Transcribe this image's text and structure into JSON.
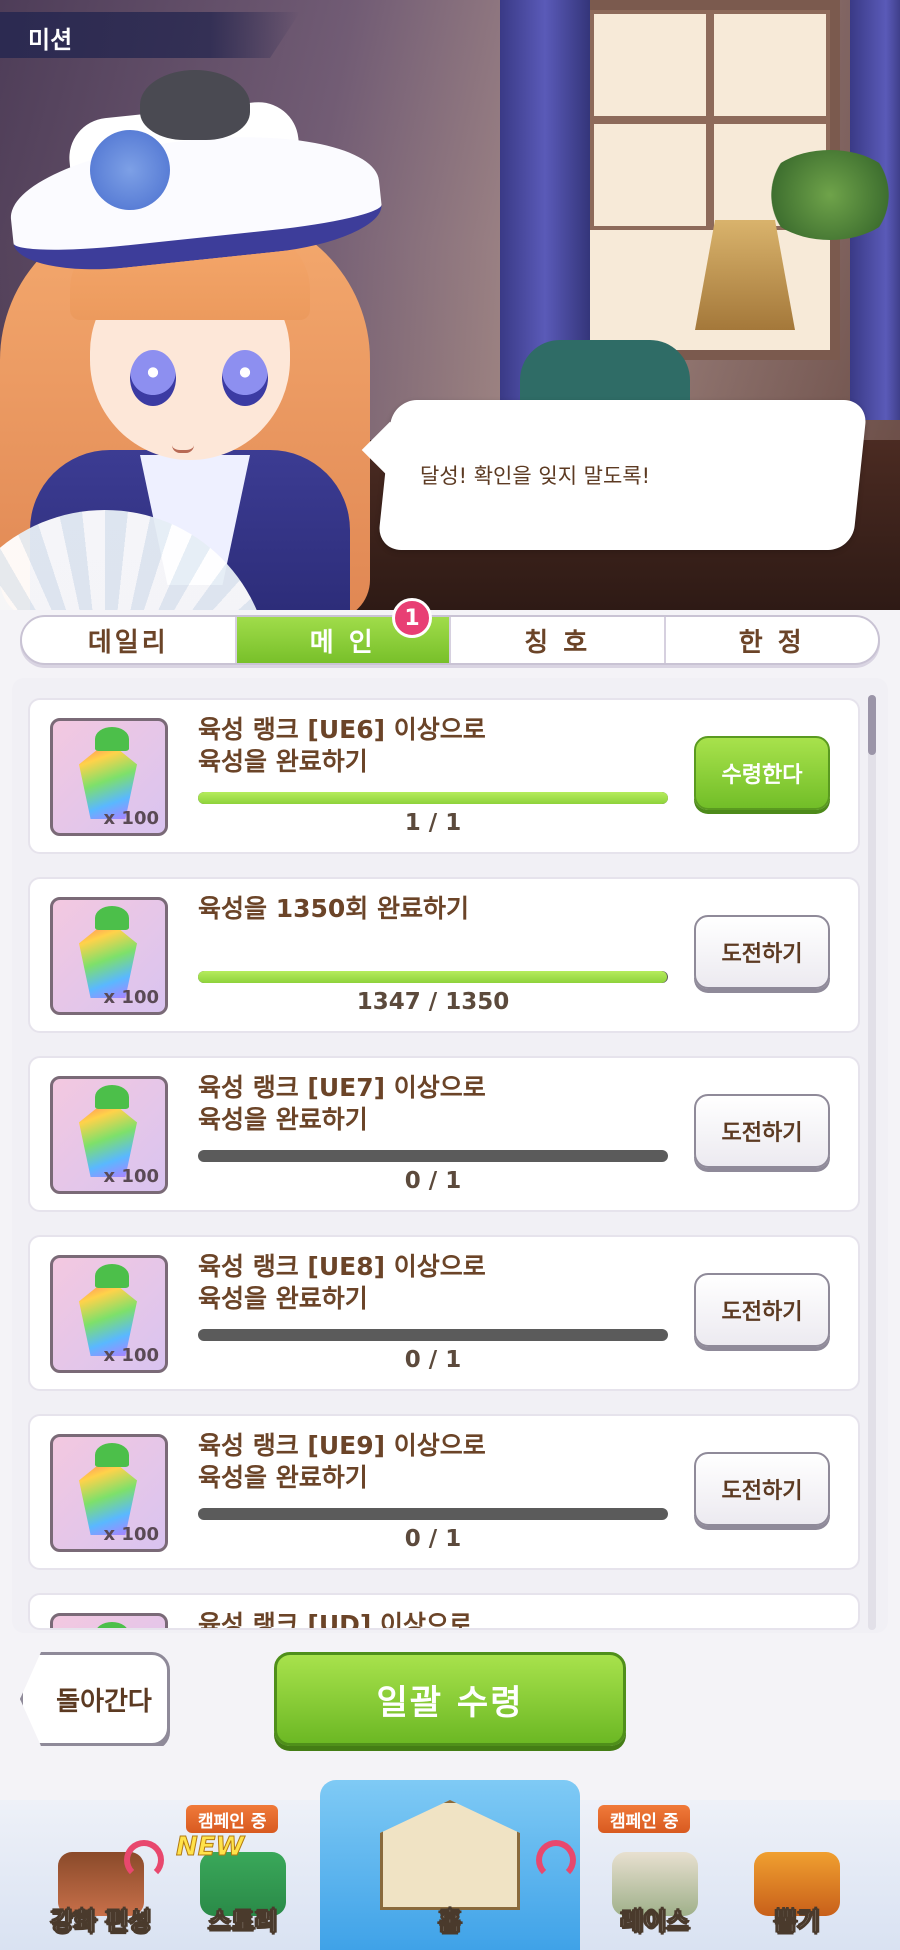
{
  "screen": {
    "title": "미션"
  },
  "speech": {
    "text": "달성! 확인을 잊지 말도록!"
  },
  "tabs": [
    {
      "label": "데일리",
      "active": false
    },
    {
      "label": "메 인",
      "active": true,
      "badge": "1"
    },
    {
      "label": "칭 호",
      "active": false
    },
    {
      "label": "한 정",
      "active": false
    }
  ],
  "missions": [
    {
      "title": "육성 랭크 [UE6] 이상으로\n육성을 완료하기",
      "reward_qty": "x 100",
      "progress_text": "1 / 1",
      "progress": 1.0,
      "button": "수령한다",
      "button_type": "claim"
    },
    {
      "title": "육성을 1350회 완료하기",
      "reward_qty": "x 100",
      "progress_text": "1347 / 1350",
      "progress": 0.9978,
      "button": "도전하기",
      "button_type": "challenge"
    },
    {
      "title": "육성 랭크 [UE7] 이상으로\n육성을 완료하기",
      "reward_qty": "x 100",
      "progress_text": "0 / 1",
      "progress": 0,
      "button": "도전하기",
      "button_type": "challenge"
    },
    {
      "title": "육성 랭크 [UE8] 이상으로\n육성을 완료하기",
      "reward_qty": "x 100",
      "progress_text": "0 / 1",
      "progress": 0,
      "button": "도전하기",
      "button_type": "challenge"
    },
    {
      "title": "육성 랭크 [UE9] 이상으로\n육성을 완료하기",
      "reward_qty": "x 100",
      "progress_text": "0 / 1",
      "progress": 0,
      "button": "도전하기",
      "button_type": "challenge"
    },
    {
      "title": "육성 랭크 [UD] 이상으로",
      "reward_qty": "",
      "progress_text": "",
      "progress": 0,
      "button": "",
      "button_type": "challenge"
    }
  ],
  "actions": {
    "back": "돌아간다",
    "bulk_claim": "일괄 수령"
  },
  "nav": {
    "items": [
      {
        "label": "강화 편성",
        "icon": "character-icon"
      },
      {
        "label": "스토리",
        "icon": "story-book-icon",
        "tag": "캠페인 중",
        "new": "NEW"
      },
      {
        "label": "홈",
        "icon": "home-building-icon"
      },
      {
        "label": "레이스",
        "icon": "race-gate-icon",
        "tag": "캠페인 중"
      },
      {
        "label": "뽑기",
        "icon": "gacha-door-icon"
      }
    ]
  },
  "colors": {
    "accent_green": "#78c02a",
    "badge_pink": "#e83f74",
    "text_brown": "#6b4428"
  }
}
